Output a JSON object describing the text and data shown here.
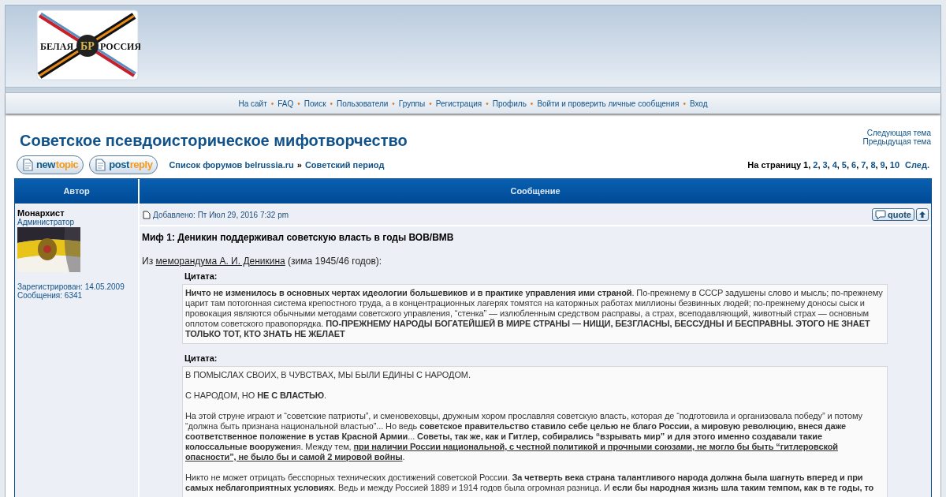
{
  "logo": {
    "left_word": "БЕЛАЯ",
    "emblem": "БР",
    "right_word": "РОССИЯ"
  },
  "nav_separator": "•",
  "nav": [
    "На сайт",
    "FAQ",
    "Поиск",
    "Пользователи",
    "Группы",
    "Регистрация",
    "Профиль",
    "Войти и проверить личные сообщения",
    "Вход"
  ],
  "topic": {
    "title": "Советское псевдоисторическое мифотворчество",
    "next": "Следующая тема",
    "prev": "Предыдущая тема"
  },
  "buttons": [
    {
      "first": "new",
      "second": "topic"
    },
    {
      "first": "post",
      "second": "reply"
    }
  ],
  "breadcrumb": {
    "items": [
      "Список форумов belrussia.ru",
      "Советский период"
    ],
    "separator": "»"
  },
  "pagination": {
    "label": "На страницу",
    "separator": ",",
    "pages": [
      {
        "label": "1",
        "selected": true
      },
      {
        "label": "2",
        "selected": false
      },
      {
        "label": "3",
        "selected": false
      },
      {
        "label": "4",
        "selected": false
      },
      {
        "label": "5",
        "selected": false
      },
      {
        "label": "6",
        "selected": false
      },
      {
        "label": "7",
        "selected": false
      },
      {
        "label": "8",
        "selected": false
      },
      {
        "label": "9",
        "selected": false
      },
      {
        "label": "10",
        "selected": false
      }
    ],
    "next": "След."
  },
  "table": {
    "columns": [
      "Автор",
      "Сообщение"
    ]
  },
  "post": {
    "author": "Монархист",
    "rank": "Администратор",
    "registered": "Зарегистрирован: 14.05.2009",
    "messages": "Сообщения: 6341",
    "added": "Добавлено: Пт Июл 29, 2016 7:32 pm",
    "quote_button": "quote",
    "subject": "Миф 1: Деникин поддерживал советскую власть в годы ВОВ/ВМВ",
    "intro": [
      {
        "kind": "plain",
        "text": "Из "
      },
      {
        "kind": "link",
        "text": "меморандума А. И. Деникина"
      },
      {
        "kind": "plain",
        "text": " (зима 1945/46 годов):"
      }
    ],
    "quotes": [
      {
        "label": "Цитата:",
        "paragraphs": [
          [
            {
              "kind": "bold",
              "text": "Ничто не изменилось в основных чертах идеологии большевиков и в практике управления ими страной"
            },
            {
              "kind": "plain",
              "text": ". По-прежнему в СССР задушены слово и мысль; по-прежнему царит там потогонная система крепостного труда, а в концентрационных лагерях томятся на каторжных работах миллионы безвинных людей; по-прежнему доносы сыск и провокация являются обычными методами советского управления, “стенка” — излюбленным средством расправы, а страх, всеподавляющий, животный страх — основным оплотом советского правопорядка. "
            },
            {
              "kind": "bold",
              "text": "ПО-ПРЕЖНЕМУ НАРОДЫ БОГАТЕЙШЕЙ В МИРЕ СТРАНЫ — НИЩИ, БЕЗГЛАСНЫ, БЕССУДНЫ И БЕСПРАВНЫ. ЭТОГО НЕ ЗНАЕТ ТОЛЬКО ТОТ, КТО ЗНАТЬ НЕ ЖЕЛАЕТ"
            }
          ]
        ]
      },
      {
        "label": "Цитата:",
        "paragraphs": [
          [
            {
              "kind": "plain",
              "text": "В ПОМЫСЛАХ СВОИХ, В ЧУВСТВАХ, МЫ БЫЛИ ЕДИНЫ С НАРОДОМ."
            }
          ],
          [
            {
              "kind": "plain",
              "text": "С НАРОДОМ, НО "
            },
            {
              "kind": "bold",
              "text": "НЕ С ВЛАСТЬЮ"
            },
            {
              "kind": "plain",
              "text": "."
            }
          ],
          [
            {
              "kind": "plain",
              "text": "На этой струне играют и “советские патриоты”, и сменовеховцы, дружным хором прославляя советскую власть, которая де “подготовила и организовала победу” и потому “должна быть признана национальной властью”... Но ведь "
            },
            {
              "kind": "bold",
              "text": "советское правительство ставило себе целью не благо России, а мировую революцию, внеся даже соответственное положение в устав Красной Армии"
            },
            {
              "kind": "plain",
              "text": "... "
            },
            {
              "kind": "bold",
              "text": "Советы, так же, как и Гитлер, собирались “взрывать мир” и для этого именно создавали такие колоссальные вооружени"
            },
            {
              "kind": "plain",
              "text": "я. Между тем, "
            },
            {
              "kind": "bold_underline",
              "text": "при наличии России национальной, с честной политикой и прочными союзами, не могло бы быть “гитлеровской опасности”, не было бы и самой 2 мировой войны"
            },
            {
              "kind": "plain",
              "text": "."
            }
          ],
          [
            {
              "kind": "plain",
              "text": "Никто не может отрицать бесспорных технических достижений советской России. "
            },
            {
              "kind": "bold",
              "text": "За четверть века страна талантливого народа должна была шагнуть вперед и при самых неблагоприятных условиях"
            },
            {
              "kind": "plain",
              "text": ". Ведь и между Россией 1889 и 1914 годов была огромная разница. И "
            },
            {
              "kind": "bold",
              "text": "если бы народная жизнь шла таким темпом, как в те годы, то"
            }
          ]
        ]
      }
    ]
  }
}
